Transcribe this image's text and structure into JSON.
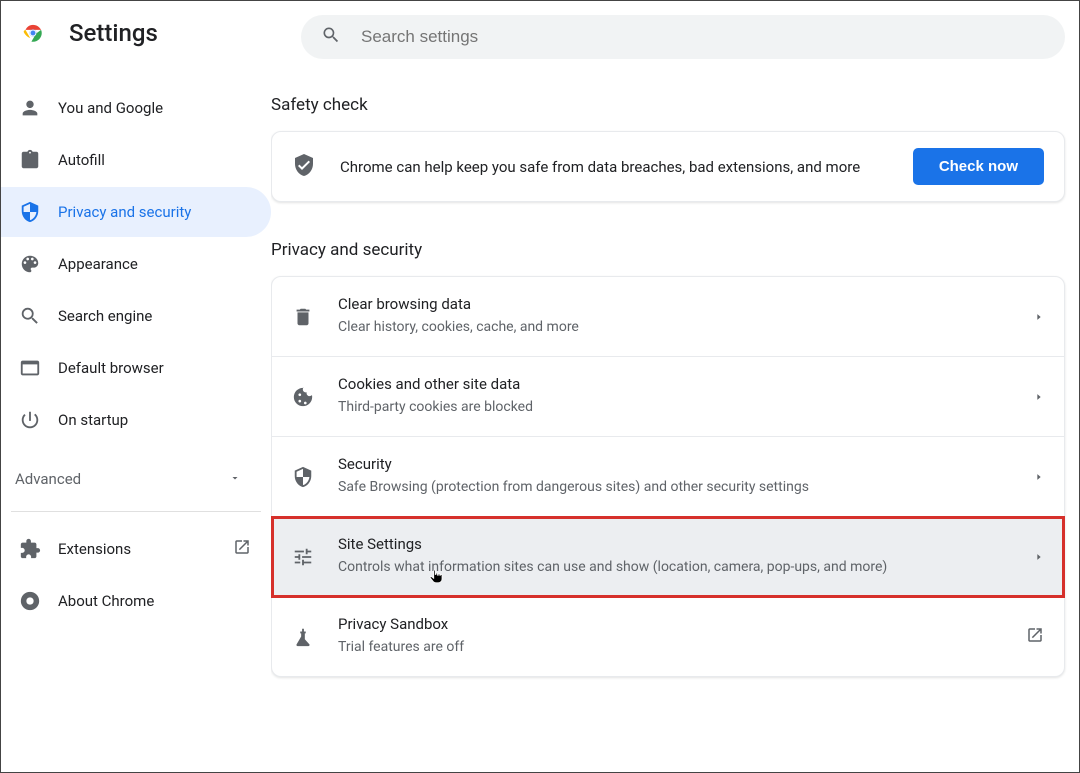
{
  "header": {
    "title": "Settings",
    "search_placeholder": "Search settings"
  },
  "sidebar": {
    "items": [
      {
        "id": "you-and-google",
        "label": "You and Google"
      },
      {
        "id": "autofill",
        "label": "Autofill"
      },
      {
        "id": "privacy-and-security",
        "label": "Privacy and security"
      },
      {
        "id": "appearance",
        "label": "Appearance"
      },
      {
        "id": "search-engine",
        "label": "Search engine"
      },
      {
        "id": "default-browser",
        "label": "Default browser"
      },
      {
        "id": "on-startup",
        "label": "On startup"
      }
    ],
    "advanced_label": "Advanced",
    "footer": [
      {
        "id": "extensions",
        "label": "Extensions"
      },
      {
        "id": "about-chrome",
        "label": "About Chrome"
      }
    ]
  },
  "main": {
    "safety_check": {
      "title": "Safety check",
      "text": "Chrome can help keep you safe from data breaches, bad extensions, and more",
      "button": "Check now"
    },
    "privacy_security": {
      "title": "Privacy and security",
      "rows": [
        {
          "title": "Clear browsing data",
          "subtitle": "Clear history, cookies, cache, and more"
        },
        {
          "title": "Cookies and other site data",
          "subtitle": "Third-party cookies are blocked"
        },
        {
          "title": "Security",
          "subtitle": "Safe Browsing (protection from dangerous sites) and other security settings"
        },
        {
          "title": "Site Settings",
          "subtitle": "Controls what information sites can use and show (location, camera, pop-ups, and more)"
        },
        {
          "title": "Privacy Sandbox",
          "subtitle": "Trial features are off"
        }
      ]
    }
  }
}
